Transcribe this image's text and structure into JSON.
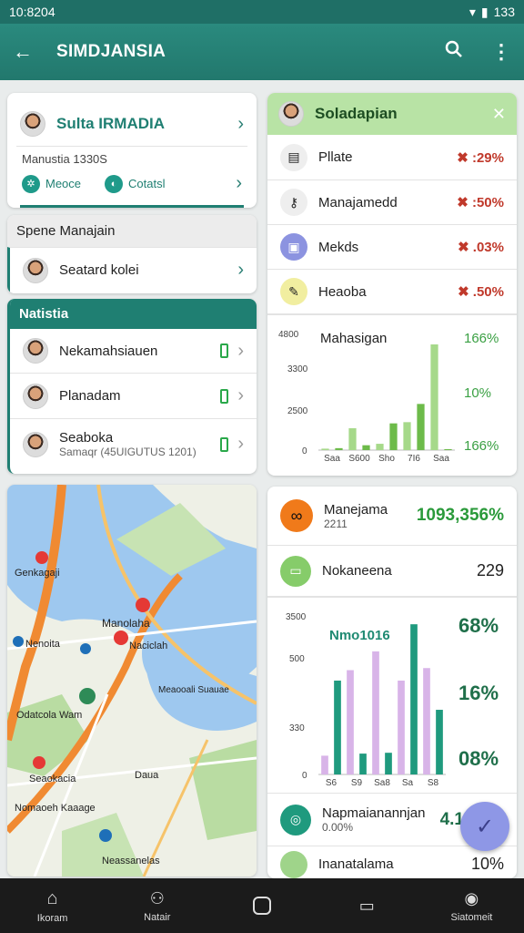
{
  "status": {
    "time": "10:8204",
    "right": "133"
  },
  "appbar": {
    "title": "SIMDJANSIA",
    "back_icon": "arrow-left-icon",
    "search_icon": "search-icon",
    "more_icon": "more-vert-icon"
  },
  "profile_card": {
    "name": "Sulta IRMADIA",
    "subtitle": "Manustia 1330S",
    "action1": "Meoce",
    "action2": "Cotatsl"
  },
  "spene_card": {
    "header": "Spene Manajain",
    "item": "Seatard kolei"
  },
  "natistia": {
    "header": "Natistia",
    "items": [
      {
        "label": "Nekamahsiauen"
      },
      {
        "label": "Planadam"
      },
      {
        "label": "Seaboka",
        "sub": "Samaqr (45UIGUTUS 1201)"
      }
    ]
  },
  "solad_panel": {
    "title": "Soladapian",
    "rows": [
      {
        "label": "Pllate",
        "value": "✖ :29%"
      },
      {
        "label": "Manajamedd",
        "value": "✖ :50%"
      },
      {
        "label": "Mekds",
        "value": "✖ .03%"
      },
      {
        "label": "Heaoba",
        "value": "✖ .50%"
      }
    ]
  },
  "chart1": {
    "title": "Mahasigan",
    "right_labels": [
      "166%",
      "10%",
      "166%"
    ]
  },
  "stats_panel": {
    "row1": {
      "label": "Manejama",
      "sub": "2211",
      "value": "1093,356%"
    },
    "row2": {
      "label": "Nokaneena",
      "value": "229"
    },
    "row3": {
      "label": "Napmaianannjan",
      "sub": "0.00%",
      "value": "4.1"
    },
    "row4": {
      "label": "Inanatalama",
      "value": "10%"
    }
  },
  "chart2": {
    "title": "Nmo1016",
    "right_labels": [
      "68%",
      "16%",
      "08%"
    ]
  },
  "map": {
    "labels": [
      "Genkagaji",
      "Manolaha",
      "Nenoita",
      "Naciclah",
      "Meaooali Suauae",
      "Odatcola Wam",
      "Seaokacia",
      "Daua",
      "Nomaoeh Kaaage",
      "Neassanelas"
    ]
  },
  "bottomnav": {
    "items": [
      "Ikoram",
      "Natair",
      "",
      "",
      "Siatomeit"
    ]
  },
  "chart_data": [
    {
      "type": "bar",
      "title": "Mahasigan",
      "categories": [
        "Saa",
        "S600",
        "Sho",
        "7I6",
        "Saa"
      ],
      "ylim": [
        0,
        4800
      ],
      "yticks": [
        "0",
        "2500",
        "3300",
        "4800"
      ],
      "series": [
        {
          "values": [
            60,
            80,
            900,
            200,
            260,
            1100,
            1150,
            1900,
            4350,
            40
          ]
        }
      ],
      "colors": [
        "#a6d98a",
        "#6dbb4a"
      ]
    },
    {
      "type": "bar",
      "title": "Nmo1016",
      "categories": [
        "S6",
        "S9",
        "Sa8",
        "Sa",
        "S8"
      ],
      "ylim": [
        0,
        3800
      ],
      "yticks": [
        "0",
        "330",
        "500",
        "3500"
      ],
      "series": [
        {
          "values": [
            450,
            2250,
            2500,
            500,
            2950,
            520,
            2250,
            3600,
            2550,
            1550
          ]
        }
      ],
      "colors": [
        "#d8b4e8",
        "#1f9a7e"
      ]
    }
  ]
}
